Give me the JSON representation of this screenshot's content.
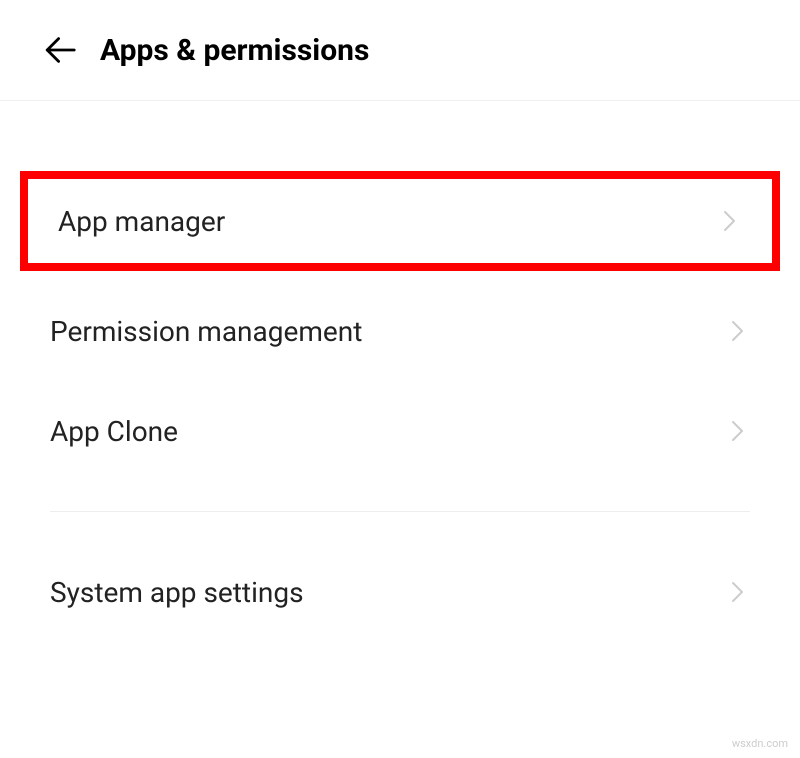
{
  "header": {
    "title": "Apps & permissions"
  },
  "items": [
    {
      "label": "App manager",
      "highlighted": true
    },
    {
      "label": "Permission management",
      "highlighted": false
    },
    {
      "label": "App Clone",
      "highlighted": false
    }
  ],
  "group2": [
    {
      "label": "System app settings"
    }
  ],
  "watermark": "wsxdn.com"
}
